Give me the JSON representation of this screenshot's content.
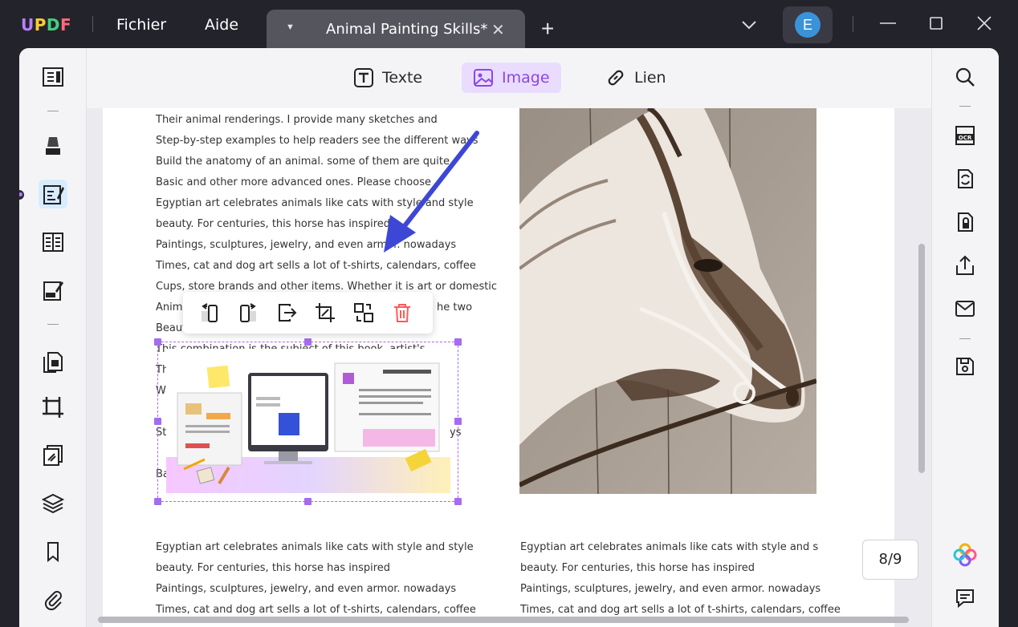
{
  "app": {
    "logo": [
      "U",
      "P",
      "D",
      "F"
    ],
    "menus": [
      "Fichier",
      "Aide"
    ],
    "tab_title": "Animal Painting Skills*",
    "avatar_initial": "E"
  },
  "toolbar": {
    "text_label": "Texte",
    "image_label": "Image",
    "link_label": "Lien",
    "active": "Image"
  },
  "left_sidebar": {
    "icons": [
      "reader-icon",
      "highlighter-icon",
      "edit-pdf-icon",
      "form-icon",
      "sign-icon",
      "organize-pages-icon",
      "crop-icon",
      "watermark-icon",
      "layers-icon",
      "bookmark-icon",
      "attachment-icon"
    ],
    "active": "edit-pdf-icon"
  },
  "right_sidebar": {
    "icons": [
      "search-icon",
      "ocr-icon",
      "convert-icon",
      "protect-icon",
      "share-icon",
      "email-icon",
      "save-icon",
      "ai-assistant-icon",
      "comment-icon"
    ]
  },
  "image_toolbar": {
    "icons": [
      "rotate-left-icon",
      "rotate-right-icon",
      "extract-icon",
      "crop-icon",
      "replace-icon",
      "delete-icon"
    ]
  },
  "document": {
    "left_column_lines": [
      "Their animal renderings. I provide many sketches and",
      "Step-by-step examples to help readers see the different ways",
      "Build the anatomy of an animal. some of them are quite",
      "Basic and other more advanced ones. Please choose",
      "Egyptian art celebrates animals like cats with style and style",
      "beauty. For centuries, this horse has inspired",
      "Paintings, sculptures, jewelry, and even armor. nowadays",
      "Times, cat and dog art sells a lot of t-shirts, calendars, coffee",
      "Cups, store brands and other items. Whether it is art or domestic",
      "Animal",
      "Beaut",
      "This combination is the subject of this book. artist's"
    ],
    "line_fragments": {
      "the_two": "he two",
      "ys": "ys",
      "th": "Th",
      "wa": "Wa",
      "st": "St",
      "ba": "Ba"
    },
    "bottom_left_lines": [
      "Egyptian art celebrates animals like cats with style and style",
      "beauty. For centuries, this horse has inspired",
      "Paintings, sculptures, jewelry, and even armor. nowadays",
      "Times, cat and dog art sells a lot of t-shirts, calendars, coffee"
    ],
    "bottom_right_lines": [
      "Egyptian art celebrates animals like cats with style and s",
      "beauty. For centuries, this horse has inspired",
      "Paintings, sculptures, jewelry, and even armor. nowadays",
      "Times, cat and dog art sells a lot of t-shirts, calendars, coffee"
    ]
  },
  "page_indicator": "8/9",
  "colors": {
    "accent": "#a56cf0",
    "arrow": "#3d47d6",
    "delete": "#ff5a5a"
  }
}
